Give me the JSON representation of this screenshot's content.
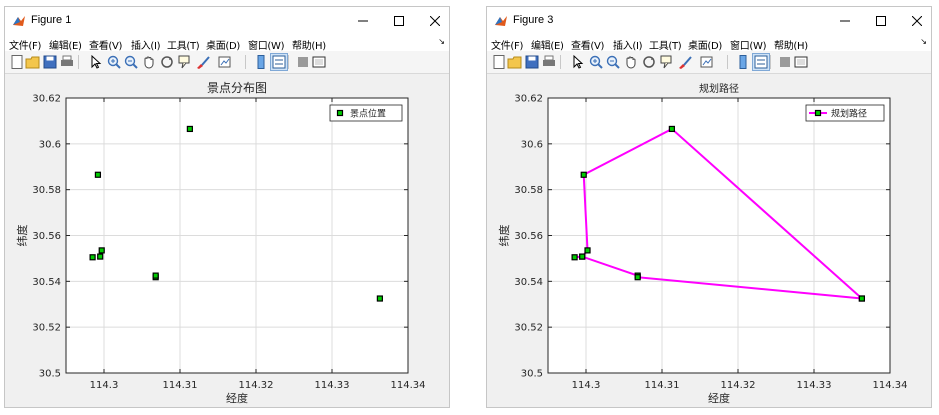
{
  "windows": [
    {
      "title": "Figure 1",
      "plot": {
        "type": "scatter",
        "title": "景点分布图",
        "xlabel": "经度",
        "ylabel": "纬度",
        "legend": "景点位置"
      }
    },
    {
      "title": "Figure 3",
      "plot": {
        "type": "path",
        "title": "规划路径",
        "xlabel": "经度",
        "ylabel": "纬度",
        "legend": "规划路径"
      }
    }
  ],
  "menu": [
    "文件(F)",
    "编辑(E)",
    "查看(V)",
    "插入(I)",
    "工具(T)",
    "桌面(D)",
    "窗口(W)",
    "帮助(H)"
  ],
  "toolbar_icons": [
    "new-figure-icon",
    "open-file-icon",
    "save-icon",
    "print-icon",
    "pointer-icon",
    "zoom-in-icon",
    "zoom-out-icon",
    "pan-icon",
    "rotate-3d-icon",
    "data-cursor-icon",
    "brush-icon",
    "link-plot-icon",
    "colorbar-icon",
    "legend-icon",
    "plot-tools-hide-icon",
    "plot-tools-show-icon"
  ],
  "colors": {
    "marker_fill": "#00cc00",
    "marker_edge": "#000000",
    "path_line": "#ff00ff",
    "grid": "#dcdcdc"
  },
  "chart_data": [
    {
      "type": "scatter",
      "title": "景点分布图",
      "xlabel": "经度",
      "ylabel": "纬度",
      "xlim": [
        114.295,
        114.34
      ],
      "ylim": [
        30.5,
        30.62
      ],
      "xticks": [
        "114.3",
        "114.31",
        "114.32",
        "114.33",
        "114.34"
      ],
      "yticks": [
        "30.5",
        "30.52",
        "30.54",
        "30.56",
        "30.58",
        "30.6",
        "30.62"
      ],
      "grid": true,
      "legend_position": "top-right",
      "series": [
        {
          "name": "景点位置",
          "x": [
            114.2985,
            114.2995,
            114.2992,
            114.2997,
            114.3068,
            114.3068,
            114.3113,
            114.3363
          ],
          "y": [
            30.5505,
            30.5508,
            30.5865,
            30.5535,
            30.5418,
            30.5425,
            30.6065,
            30.5325
          ]
        }
      ]
    },
    {
      "type": "line",
      "title": "规划路径",
      "xlabel": "经度",
      "ylabel": "纬度",
      "xlim": [
        114.295,
        114.34
      ],
      "ylim": [
        30.5,
        30.62
      ],
      "xticks": [
        "114.3",
        "114.31",
        "114.32",
        "114.33",
        "114.34"
      ],
      "yticks": [
        "30.5",
        "30.52",
        "30.54",
        "30.56",
        "30.58",
        "30.6",
        "30.62"
      ],
      "grid": true,
      "legend_position": "top-right",
      "series": [
        {
          "name": "规划路径",
          "x": [
            114.3363,
            114.3113,
            114.2997,
            114.3002,
            114.2995,
            114.2985,
            114.2995,
            114.3068,
            114.3068,
            114.3363
          ],
          "y": [
            30.5325,
            30.6065,
            30.5865,
            30.5535,
            30.5508,
            30.5505,
            30.5508,
            30.5425,
            30.5418,
            30.5325
          ]
        }
      ]
    }
  ]
}
